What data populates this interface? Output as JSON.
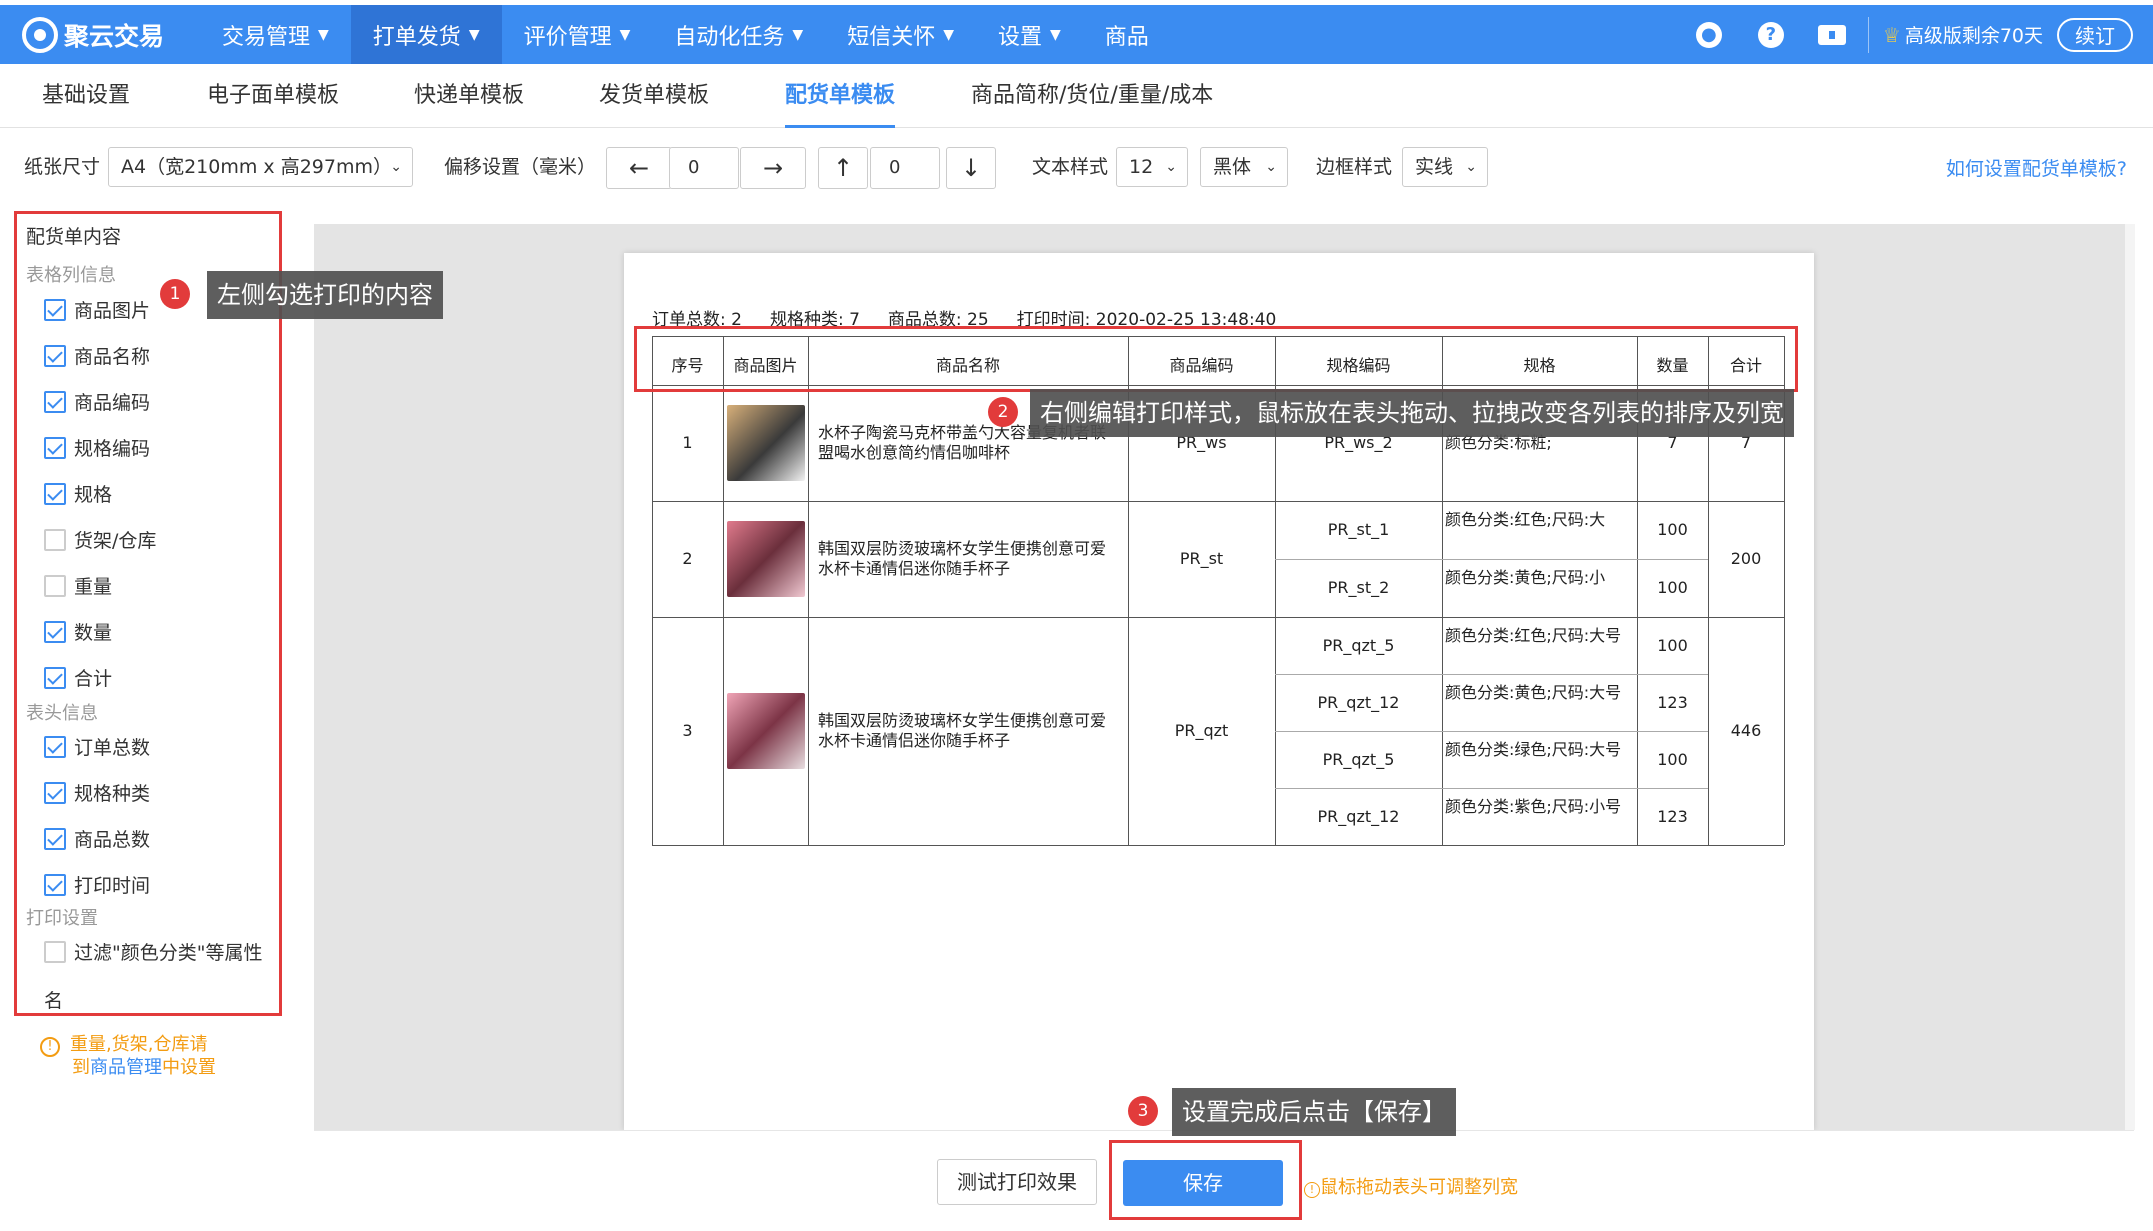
{
  "app": {
    "logo_text": "聚云交易"
  },
  "nav": [
    {
      "label": "交易管理",
      "caret": true
    },
    {
      "label": "打单发货",
      "caret": true,
      "active": true
    },
    {
      "label": "评价管理",
      "caret": true
    },
    {
      "label": "自动化任务",
      "caret": true
    },
    {
      "label": "短信关怀",
      "caret": true
    },
    {
      "label": "设置",
      "caret": true
    },
    {
      "label": "商品",
      "caret": false
    }
  ],
  "topright": {
    "help": "?",
    "vip_text": "高级版剩余70天",
    "renew": "续订"
  },
  "subtabs": [
    "基础设置",
    "电子面单模板",
    "快递单模板",
    "发货单模板",
    "配货单模板",
    "商品简称/货位/重量/成本"
  ],
  "toolbar": {
    "paper_label": "纸张尺寸",
    "paper_value": "A4（宽210mm x 高297mm）",
    "offset_label": "偏移设置（毫米）",
    "left_arrow": "←",
    "x_value": "0",
    "right_arrow": "→",
    "up_arrow": "↑",
    "y_value": "0",
    "down_arrow": "↓",
    "text_style_label": "文本样式",
    "font_size": "12",
    "font_family": "黑体",
    "border_style_label": "边框样式",
    "border_style": "实线",
    "help_link": "如何设置配货单模板?"
  },
  "left": {
    "title": "配货单内容",
    "group_table": "表格列信息",
    "table_items": [
      {
        "label": "商品图片",
        "checked": true
      },
      {
        "label": "商品名称",
        "checked": true
      },
      {
        "label": "商品编码",
        "checked": true
      },
      {
        "label": "规格编码",
        "checked": true
      },
      {
        "label": "规格",
        "checked": true
      },
      {
        "label": "货架/仓库",
        "checked": false
      },
      {
        "label": "重量",
        "checked": false
      },
      {
        "label": "数量",
        "checked": true
      },
      {
        "label": "合计",
        "checked": true
      }
    ],
    "group_header": "表头信息",
    "header_items": [
      {
        "label": "订单总数",
        "checked": true
      },
      {
        "label": "规格种类",
        "checked": true
      },
      {
        "label": "商品总数",
        "checked": true
      },
      {
        "label": "打印时间",
        "checked": true
      }
    ],
    "group_print": "打印设置",
    "print_item_line1": "过滤\"颜色分类\"等属性",
    "print_item_line2": "名",
    "note_line1": "重量,货架,仓库请",
    "note_line2_a": "到",
    "note_line2_link": "商品管理",
    "note_line2_b": "中设置"
  },
  "paper": {
    "summary": [
      "订单总数: 2",
      "规格种类: 7",
      "商品总数: 25",
      "打印时间: 2020-02-25 13:48:40"
    ],
    "headers": [
      "序号",
      "商品图片",
      "商品名称",
      "商品编码",
      "规格编码",
      "规格",
      "数量",
      "合计"
    ],
    "rows": [
      {
        "seq": "1",
        "name": "水杯子陶瓷马克杯带盖勺大容量复机者联盟喝水创意简约情侣咖啡杯",
        "code": "PR_ws",
        "skus": [
          {
            "sku": "PR_ws_2",
            "spec": "颜色分类:标粧;",
            "qty": "7"
          }
        ],
        "total": "7"
      },
      {
        "seq": "2",
        "name": "韩国双层防烫玻璃杯女学生便携创意可爱水杯卡通情侣迷你随手杯子",
        "code": "PR_st",
        "skus": [
          {
            "sku": "PR_st_1",
            "spec": "颜色分类:红色;尺码:大",
            "qty": "100"
          },
          {
            "sku": "PR_st_2",
            "spec": "颜色分类:黄色;尺码:小",
            "qty": "100"
          }
        ],
        "total": "200"
      },
      {
        "seq": "3",
        "name": "韩国双层防烫玻璃杯女学生便携创意可爱水杯卡通情侣迷你随手杯子",
        "code": "PR_qzt",
        "skus": [
          {
            "sku": "PR_qzt_5",
            "spec": "颜色分类:红色;尺码:大号",
            "qty": "100"
          },
          {
            "sku": "PR_qzt_12",
            "spec": "颜色分类:黄色;尺码:大号",
            "qty": "123"
          },
          {
            "sku": "PR_qzt_5",
            "spec": "颜色分类:绿色;尺码:大号",
            "qty": "100"
          },
          {
            "sku": "PR_qzt_12",
            "spec": "颜色分类:紫色;尺码:小号",
            "qty": "123"
          }
        ],
        "total": "446"
      }
    ]
  },
  "bottom": {
    "test_button": "测试打印效果",
    "save_button": "保存",
    "tip": "鼠标拖动表头可调整列宽"
  },
  "callouts": [
    {
      "num": "1",
      "text": "左侧勾选打印的内容"
    },
    {
      "num": "2",
      "text": "右侧编辑打印样式，鼠标放在表头拖动、拉拽改变各列表的排序及列宽"
    },
    {
      "num": "3",
      "text": "设置完成后点击【保存】"
    }
  ],
  "colors": {
    "primary": "#3b8cf1",
    "nav_active": "#2f74d6",
    "highlight": "#e23b3b",
    "warning": "#f39c12"
  }
}
